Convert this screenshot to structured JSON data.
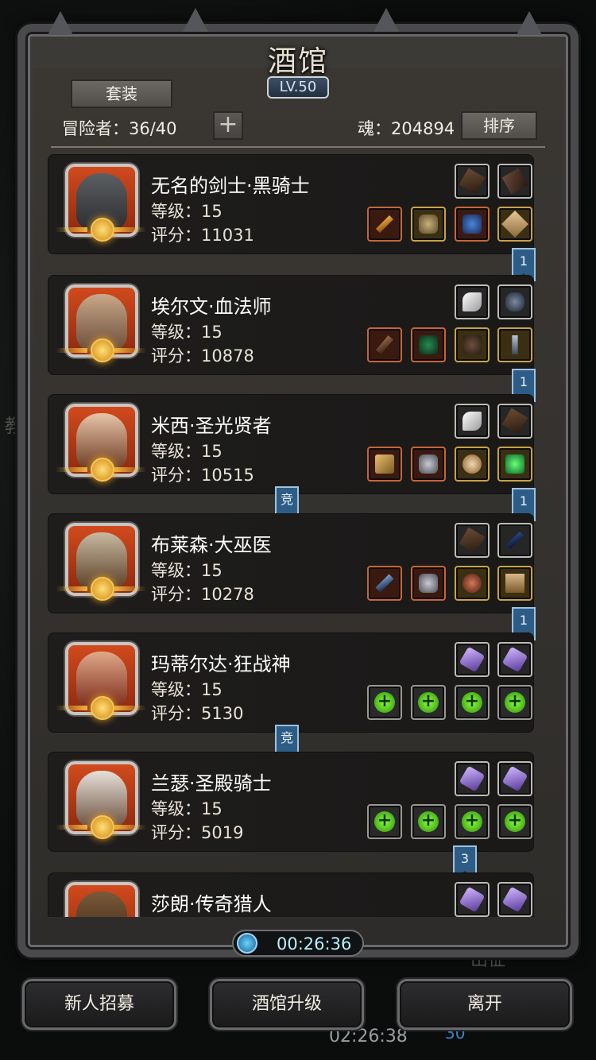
{
  "window": {
    "title": "酒馆",
    "level": "LV.50"
  },
  "header": {
    "set_label": "套装",
    "adventurers": "冒险者：36/40",
    "add_label": "+",
    "soul": "魂：204894",
    "sort_label": "排序"
  },
  "heroes": [
    {
      "name": "无名的剑士·黑骑士",
      "level": "等级：15",
      "score": "评分：11031",
      "flag": "1"
    },
    {
      "name": "埃尔文·血法师",
      "level": "等级：15",
      "score": "评分：10878",
      "flag": "1"
    },
    {
      "name": "米西·圣光贤者",
      "level": "等级：15",
      "score": "评分：10515",
      "flag": "1",
      "badge": "竞"
    },
    {
      "name": "布莱森·大巫医",
      "level": "等级：15",
      "score": "评分：10278",
      "flag": "1"
    },
    {
      "name": "玛蒂尔达·狂战神",
      "level": "等级：15",
      "score": "评分：5130",
      "badge": "竞"
    },
    {
      "name": "兰瑟·圣殿骑士",
      "level": "等级：15",
      "score": "评分：5019",
      "flag": "3"
    },
    {
      "name": "莎朗·传奇猎人"
    }
  ],
  "timer": "00:26:36",
  "footer": {
    "recruit": "新人招募",
    "upgrade": "酒馆升级",
    "leave": "离开"
  },
  "background": {
    "side_text": "教",
    "clock": "02:26:38",
    "count": "30",
    "ghost": "出征"
  },
  "icons": [
    "gear-icon",
    "sword-icon",
    "helmet-icon",
    "armor-icon",
    "ring-icon",
    "wing-icon",
    "mask-icon",
    "crystal-icon",
    "plus-icon",
    "clock-icon"
  ]
}
